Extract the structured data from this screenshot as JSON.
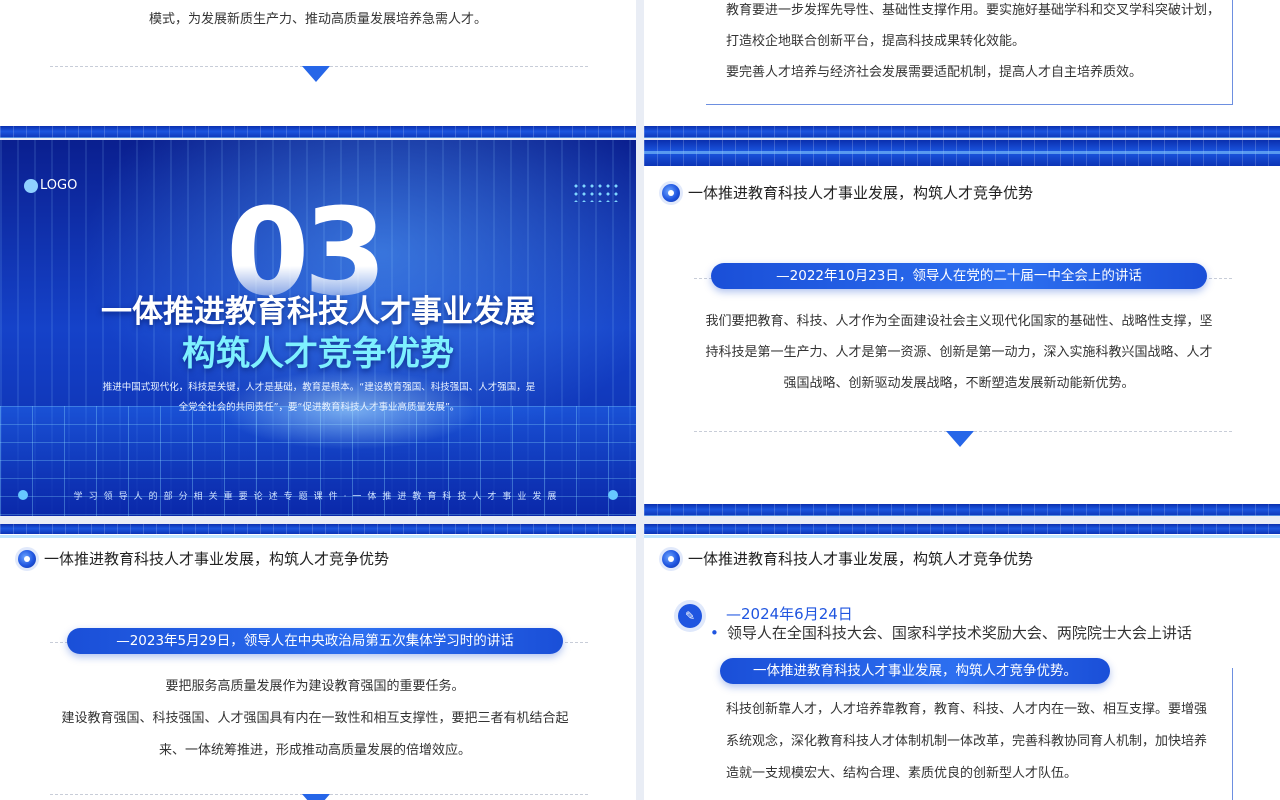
{
  "top_left": {
    "text": "模式，为发展新质生产力、推动高质量发展培养急需人才。"
  },
  "top_right": {
    "lines": [
      "教育要进一步发挥先导性、基础性支撑作用。要实施好基础学科和交叉学科突破计划，",
      "打造校企地联合创新平台，提高科技成果转化效能。",
      "要完善人才培养与经济社会发展需要适配机制，提高人才自主培养质效。"
    ]
  },
  "cover": {
    "logo": "LOGO",
    "number": "03",
    "title": "一体推进教育科技人才事业发展",
    "subtitle": "构筑人才竞争优势",
    "desc_line1": "推进中国式现代化，科技是关键，人才是基础，教育是根本。“建设教育强国、科技强国、人才强国，是",
    "desc_line2": "全党全社会的共同责任”，要“促进教育科技人才事业高质量发展”。",
    "footer": "学习领导人的部分相关重要论述专题课件·一体推进教育科技人才事业发展"
  },
  "mid_right": {
    "heading": "一体推进教育科技人才事业发展，构筑人才竞争优势",
    "pill": "—2022年10月23日，领导人在党的二十届一中全会上的讲话",
    "lines": [
      "我们要把教育、科技、人才作为全面建设社会主义现代化国家的基础性、战略性支撑，坚",
      "持科技是第一生产力、人才是第一资源、创新是第一动力，深入实施科教兴国战略、人才",
      "强国战略、创新驱动发展战略，不断塑造发展新动能新优势。"
    ]
  },
  "bottom_left": {
    "heading": "一体推进教育科技人才事业发展，构筑人才竞争优势",
    "pill": "—2023年5月29日，领导人在中央政治局第五次集体学习时的讲话",
    "lines": [
      "要把服务高质量发展作为建设教育强国的重要任务。",
      "建设教育强国、科技强国、人才强国具有内在一致性和相互支撑性，要把三者有机结合起",
      "来、一体统筹推进，形成推动高质量发展的倍增效应。"
    ]
  },
  "bottom_right": {
    "heading": "一体推进教育科技人才事业发展，构筑人才竞争优势",
    "date": "—2024年6月24日",
    "event": "领导人在全国科技大会、国家科学技术奖励大会、两院院士大会上讲话",
    "pill": "一体推进教育科技人才事业发展，构筑人才竞争优势。",
    "lines": [
      "科技创新靠人才，人才培养靠教育，教育、科技、人才内在一致、相互支撑。要增强",
      "系统观念，深化教育科技人才体制机制一体改革，完善科教协同育人机制，加快培养",
      "造就一支规模宏大、结构合理、素质优良的创新型人才队伍。"
    ]
  }
}
